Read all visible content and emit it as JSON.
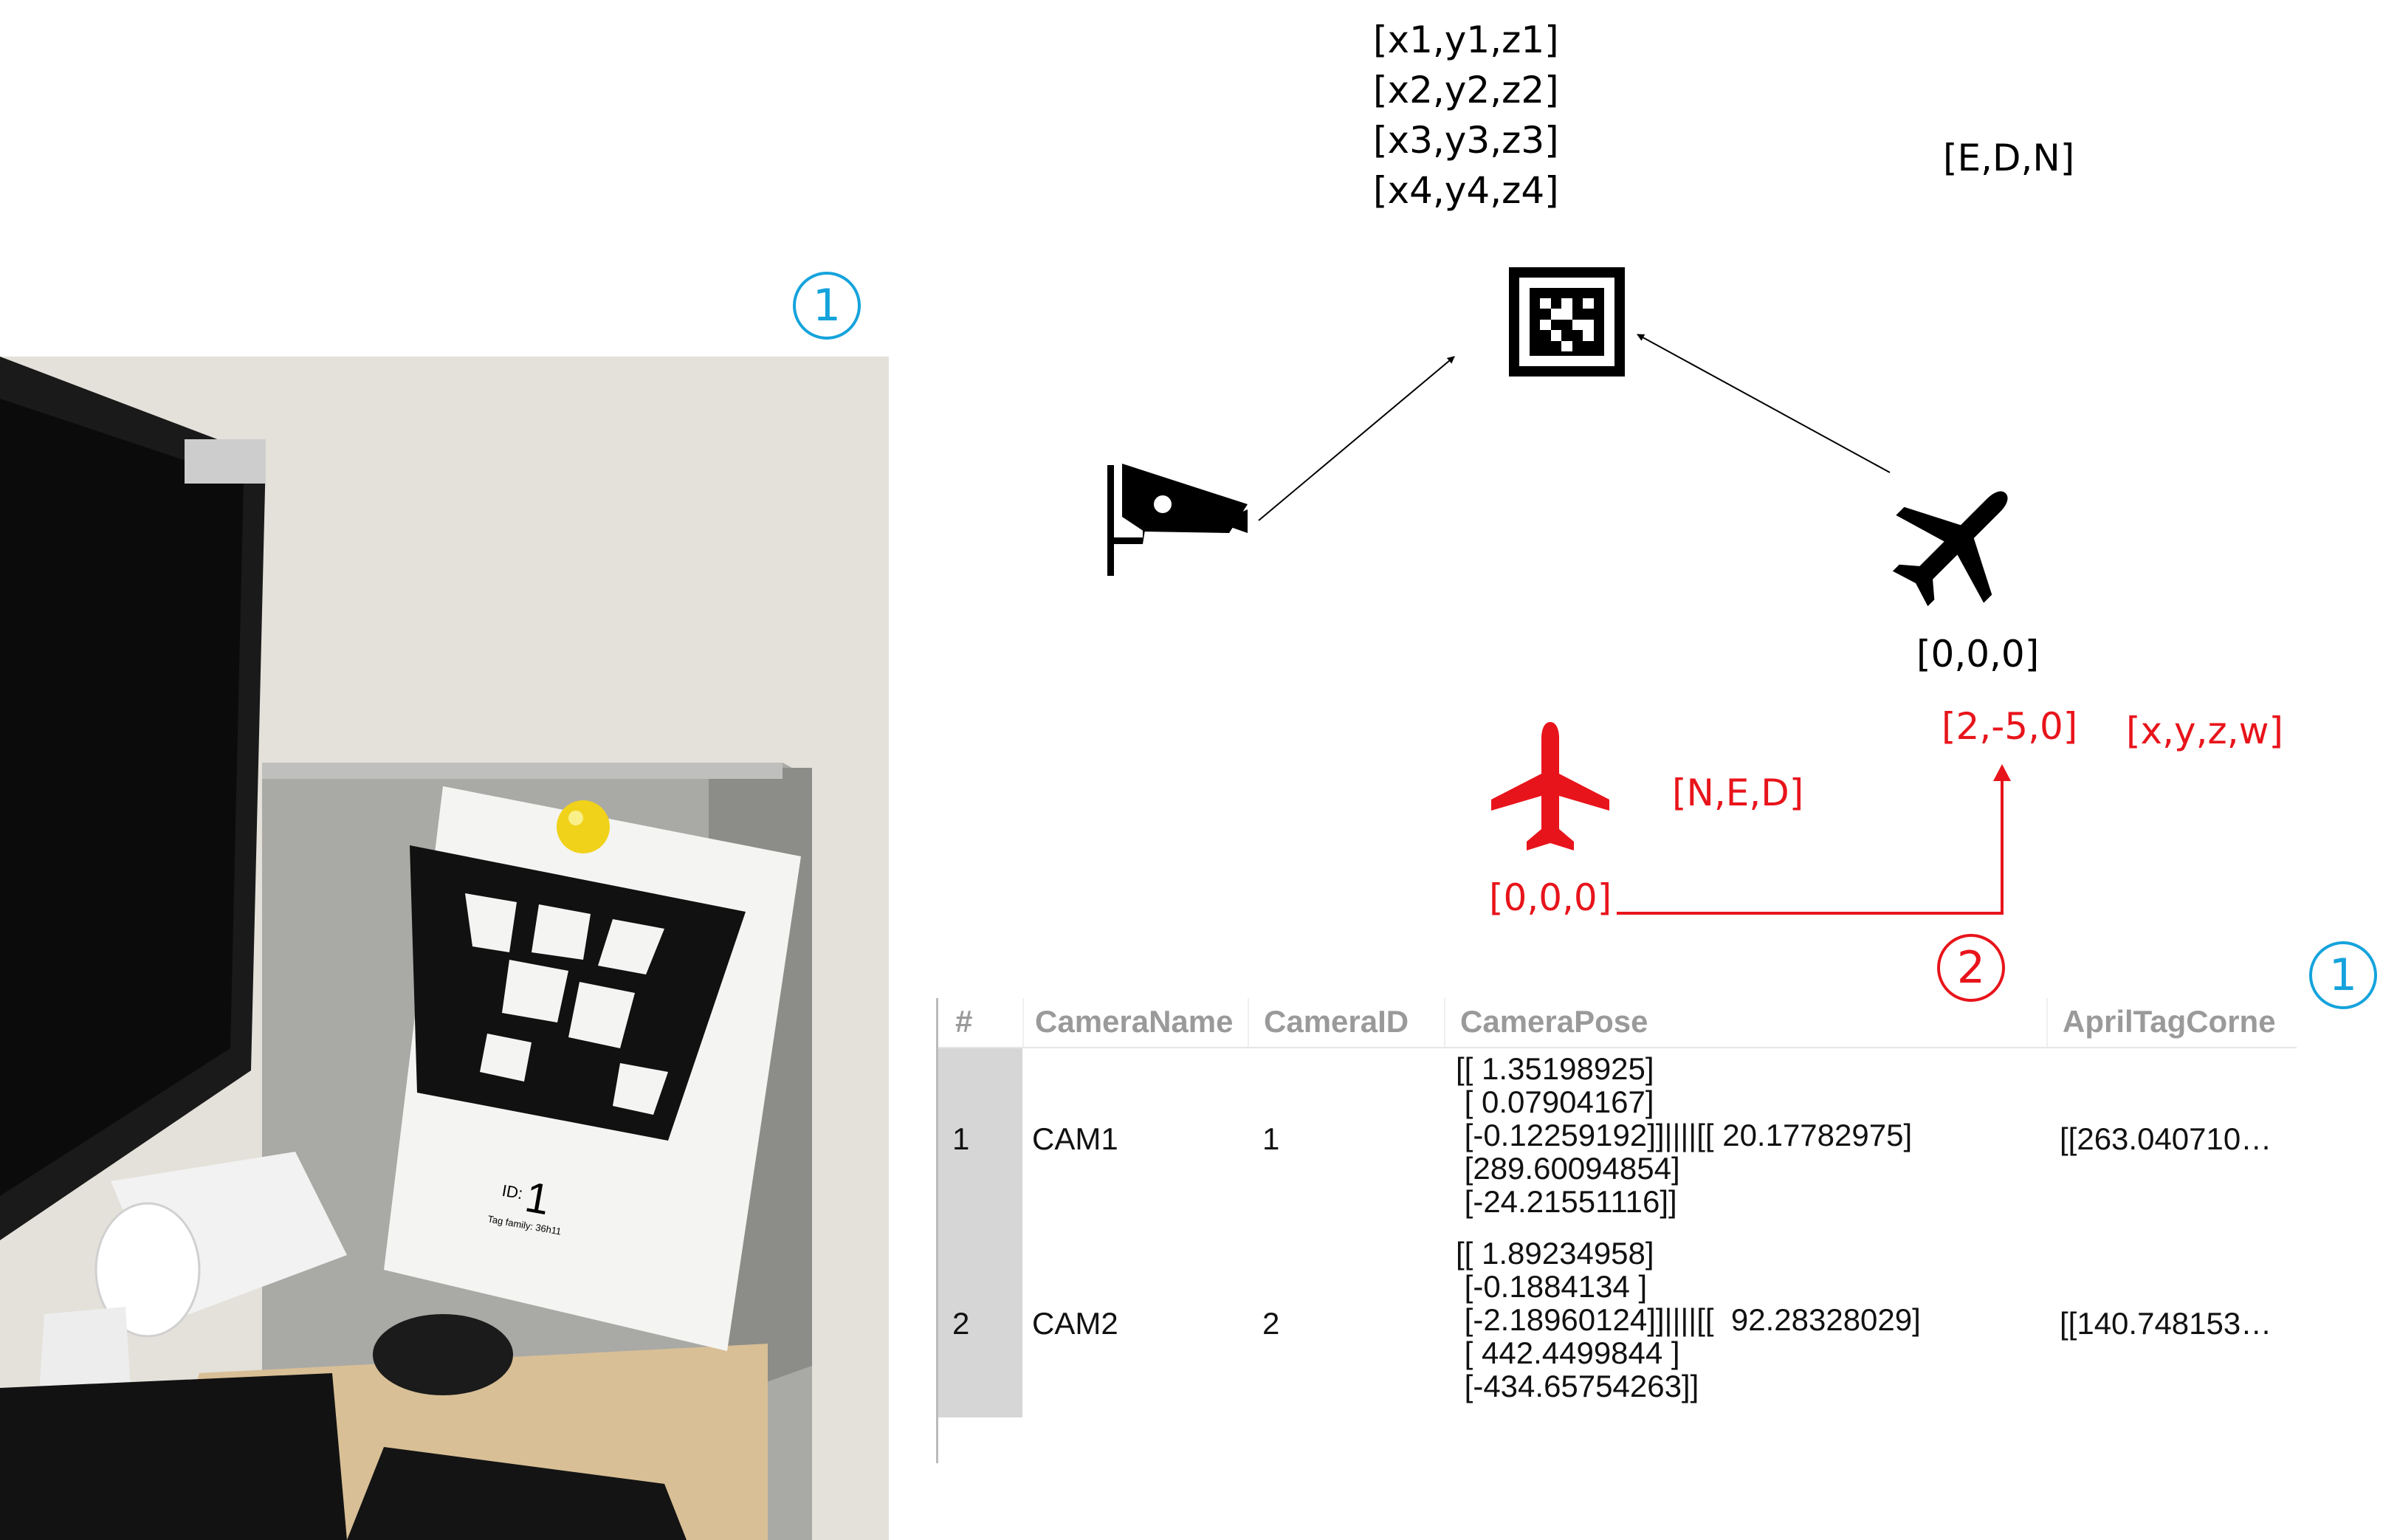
{
  "coords_top": [
    "[x1,y1,z1]",
    "[x2,y2,z2]",
    "[x3,y3,z3]",
    "[x4,y4,z4]"
  ],
  "label_edn": "[E,D,N]",
  "label_origin_black": "[0,0,0]",
  "label_offset_red": "[2,-5,0]",
  "label_quat_red": "[x,y,z,w]",
  "label_ned_red": "[N,E,D]",
  "label_origin_red": "[0,0,0]",
  "markers": {
    "blue_1": "1",
    "red_2": "2"
  },
  "photo": {
    "tag_id_label": "ID:",
    "tag_id_value": "1",
    "tag_family": "Tag family: 36h11"
  },
  "table": {
    "headers": [
      "#",
      "CameraName",
      "CameraID",
      "CameraPose",
      "AprilTagCorne"
    ],
    "rows": [
      {
        "index": "1",
        "name": "CAM1",
        "id": "1",
        "pose": "[[ 1.35198925]\n [ 0.07904167]\n [-0.12259192]]||||[[ 20.17782975]\n [289.60094854]\n [-24.21551116]]",
        "corners": "[[263.040710…"
      },
      {
        "index": "2",
        "name": "CAM2",
        "id": "2",
        "pose": "[[ 1.89234958]\n [-0.1884134 ]\n [-2.18960124]]||||[[  92.28328029]\n [ 442.4499844 ]\n [-434.65754263]]",
        "corners": "[[140.748153…"
      }
    ]
  },
  "colors": {
    "red": "#e8141b",
    "blue": "#15a3dc",
    "header_gray": "#9a9a9a",
    "rowhdr_gray": "#d6d6d6"
  },
  "icons": [
    "apriltag-icon",
    "security-camera-icon",
    "airplane-icon",
    "airplane-red-icon",
    "arrow"
  ]
}
